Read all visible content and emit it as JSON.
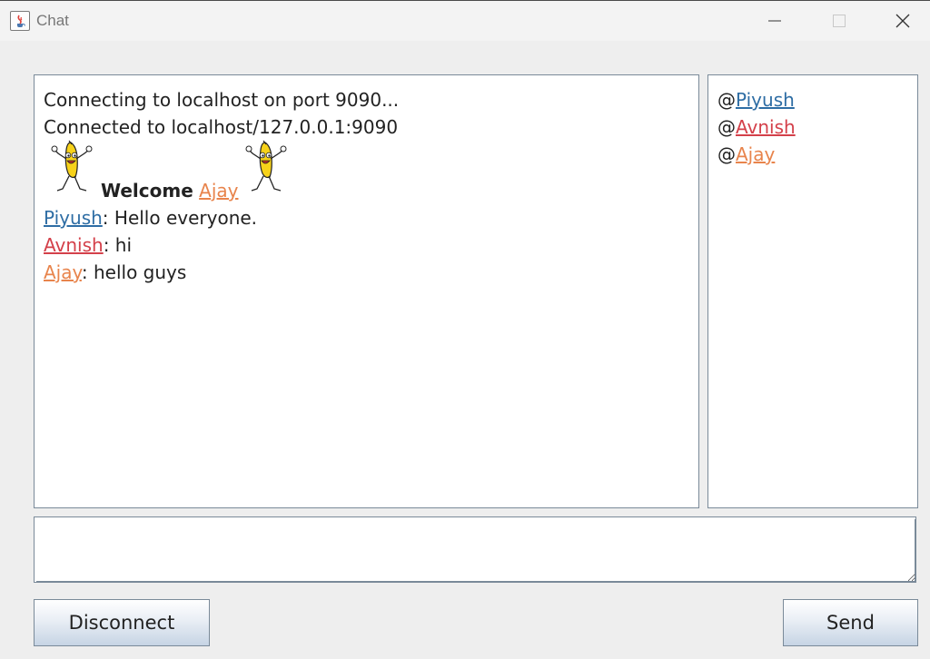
{
  "window": {
    "title": "Chat",
    "icon": "java-cup-icon",
    "controls": [
      "minimize-icon",
      "maximize-icon",
      "close-icon"
    ]
  },
  "colors": {
    "piyush": "#2e6da4",
    "avnish": "#d4404a",
    "ajay": "#e8844c"
  },
  "chat": {
    "system_lines": [
      "Connecting to localhost on port 9090...",
      "Connected to localhost/127.0.0.1:9090"
    ],
    "welcome": {
      "label": "Welcome",
      "user": "Ajay",
      "decoration_icon": "dancing-banana-icon"
    },
    "messages": [
      {
        "user": "Piyush",
        "sep": ":",
        "text": " Hello everyone."
      },
      {
        "user": "Avnish",
        "sep": ":",
        "text": " hi"
      },
      {
        "user": "Ajay",
        "sep": ":",
        "text": " hello guys"
      }
    ]
  },
  "users": {
    "prefix": "@",
    "list": [
      "Piyush",
      "Avnish",
      "Ajay"
    ]
  },
  "input": {
    "value": "",
    "placeholder": ""
  },
  "buttons": {
    "disconnect": "Disconnect",
    "send": "Send"
  }
}
